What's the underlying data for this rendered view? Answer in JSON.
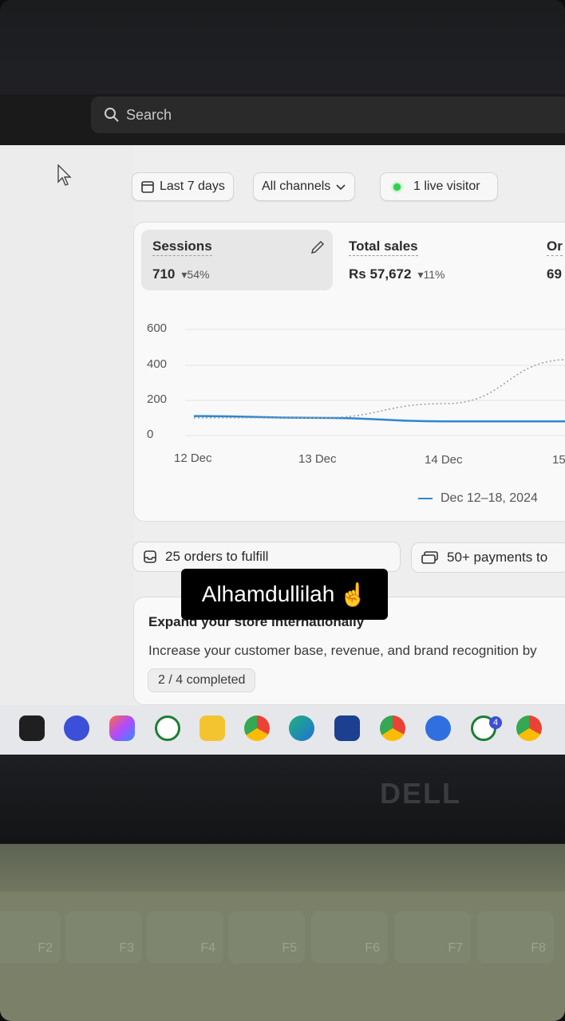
{
  "search": {
    "label": "Search"
  },
  "filters": {
    "date_range": "Last 7 days",
    "channels": "All channels",
    "live_visitors": "1 live visitor"
  },
  "metrics": [
    {
      "title": "Sessions",
      "value": "710",
      "change": "54%"
    },
    {
      "title": "Total sales",
      "value": "Rs 57,672",
      "change": "11%"
    },
    {
      "title": "Or",
      "value": "69"
    }
  ],
  "chart_data": {
    "type": "line",
    "y_ticks": [
      "600",
      "400",
      "200",
      "0"
    ],
    "x_ticks": [
      "12 Dec",
      "13 Dec",
      "14 Dec",
      "15"
    ],
    "ylim": [
      0,
      600
    ],
    "series": [
      {
        "name": "Dec 12–18, 2024",
        "x": [
          "12 Dec",
          "13 Dec",
          "14 Dec",
          "15"
        ],
        "values": [
          110,
          100,
          80,
          80
        ]
      },
      {
        "x": [
          "12 Dec",
          "13 Dec",
          "14 Dec",
          "15"
        ],
        "values": [
          100,
          100,
          180,
          430
        ]
      }
    ]
  },
  "tasks": {
    "orders": "25 orders to fulfill",
    "payments": "50+ payments to"
  },
  "expand": {
    "title": "Expand your store internationally",
    "text": "Increase your customer base, revenue, and brand recognition by",
    "progress": "2 / 4 completed"
  },
  "overlay": {
    "text": "Alhamdullilah",
    "emoji": "☝️"
  },
  "taskbar": {
    "whatsapp_badge": "4"
  },
  "laptop": {
    "brand": "DELL",
    "keys": [
      "F2",
      "F3",
      "F4",
      "F5",
      "F6",
      "F7",
      "F8"
    ]
  },
  "colors": {
    "accent_line": "#2c87d3",
    "live_dot": "#2fd04d"
  }
}
